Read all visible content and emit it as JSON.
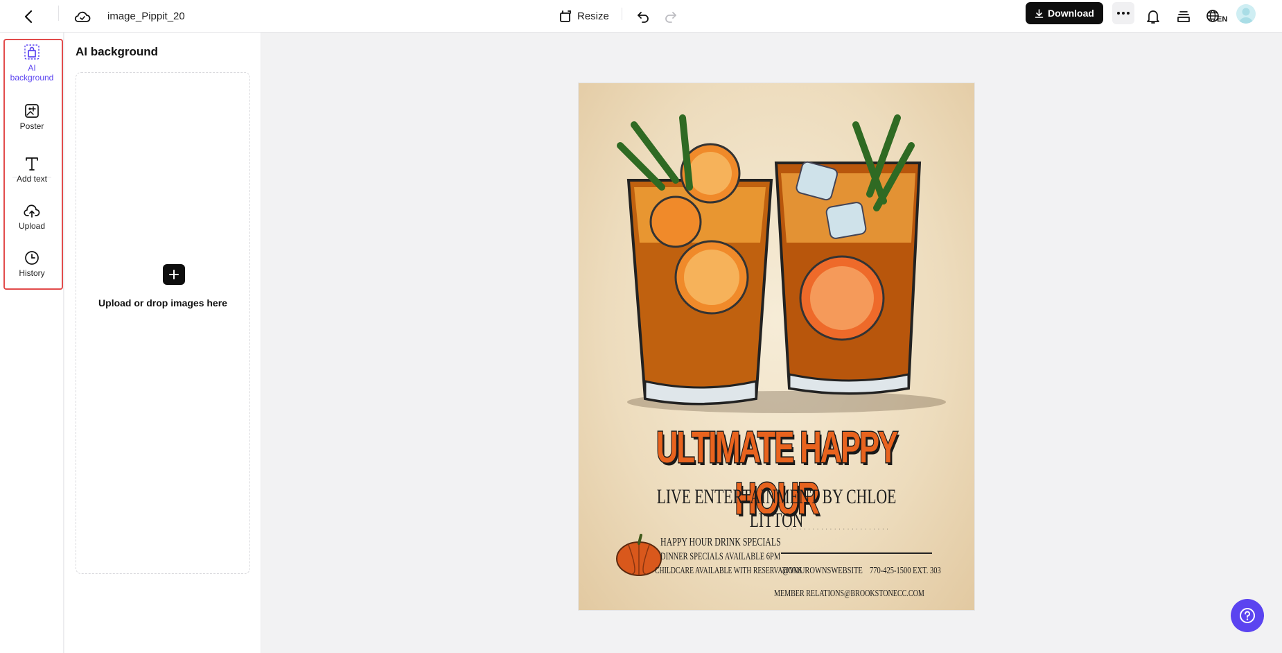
{
  "header": {
    "title": "image_Pippit_20",
    "resize_label": "Resize",
    "download_label": "Download",
    "lang_label": "EN"
  },
  "rail": {
    "items": [
      {
        "label": "AI background",
        "icon": "ai-background-icon",
        "active": true
      },
      {
        "label": "Poster",
        "icon": "poster-icon"
      },
      {
        "label": "Add text",
        "icon": "text-icon"
      },
      {
        "label": "Upload",
        "icon": "upload-cloud-icon"
      },
      {
        "label": "History",
        "icon": "clock-icon"
      }
    ]
  },
  "panel": {
    "title": "AI background",
    "upload_label": "Upload or drop images here"
  },
  "poster": {
    "title": "ULTIMATE HAPPY HOUR",
    "subtitle": "LIVE ENTERTAINMENT BY CHLOE LITTON",
    "specials": [
      "HAPPY HOUR DRINK SPECIALS",
      "DINNER SPECIALS AVAILABLE 6PM",
      "CHILDCARE AVAILABLE WITH RESERVATIONS"
    ],
    "website": "@YOUROWNSWEBSITE",
    "phone": "770-425-1500 EXT. 303",
    "email": "MEMBER RELATIONS@BROOKSTONECC.COM"
  },
  "colors": {
    "accent": "#5b44f0",
    "highlight_outline": "#e24b4b",
    "title_orange": "#e8631e"
  }
}
